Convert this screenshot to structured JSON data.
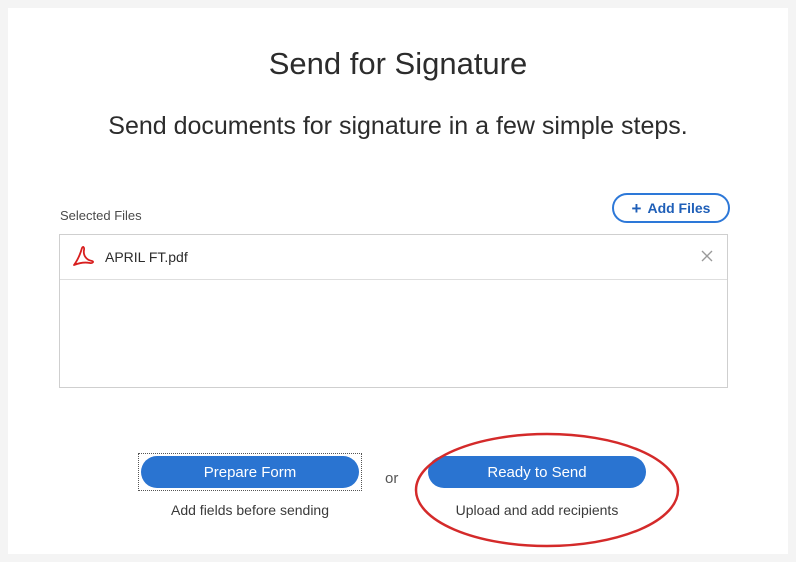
{
  "header": {
    "title": "Send for Signature",
    "subtitle": "Send documents for signature in a few simple steps."
  },
  "files": {
    "label": "Selected Files",
    "add_button_label": "Add Files",
    "items": [
      {
        "name": "APRIL FT.pdf",
        "icon": "pdf-icon"
      }
    ]
  },
  "actions": {
    "prepare": {
      "label": "Prepare Form",
      "description": "Add fields before sending"
    },
    "separator": "or",
    "ready": {
      "label": "Ready to Send",
      "description": "Upload and add recipients"
    }
  },
  "colors": {
    "primary": "#2a74d1",
    "outline": "#2d78d8",
    "pdf_red": "#d81e1e",
    "annotation_red": "#d42a2a"
  }
}
